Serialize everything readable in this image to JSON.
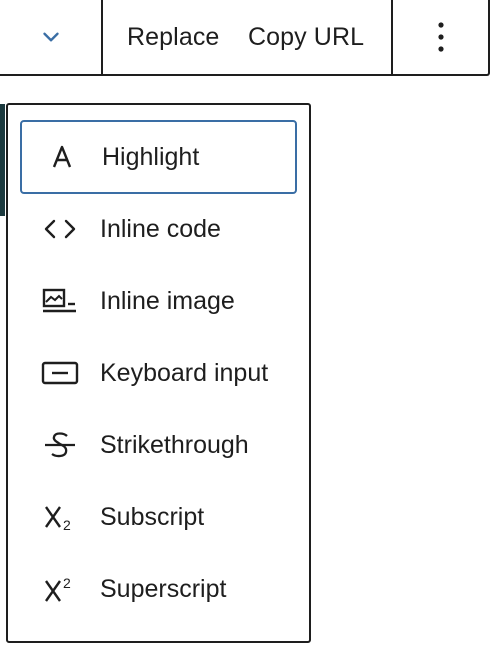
{
  "toolbar": {
    "replace_label": "Replace",
    "copy_url_label": "Copy URL",
    "chevron_icon": "chevron-down-icon",
    "more_icon": "more-vertical-icon",
    "accent_color": "#3a6ea5"
  },
  "menu": {
    "items": [
      {
        "label": "Highlight",
        "icon": "highlight-icon",
        "focused": true
      },
      {
        "label": "Inline code",
        "icon": "code-icon",
        "focused": false
      },
      {
        "label": "Inline image",
        "icon": "image-icon",
        "focused": false
      },
      {
        "label": "Keyboard input",
        "icon": "keyboard-icon",
        "focused": false
      },
      {
        "label": "Strikethrough",
        "icon": "strikethrough-icon",
        "focused": false
      },
      {
        "label": "Subscript",
        "icon": "subscript-icon",
        "focused": false
      },
      {
        "label": "Superscript",
        "icon": "superscript-icon",
        "focused": false
      }
    ]
  }
}
